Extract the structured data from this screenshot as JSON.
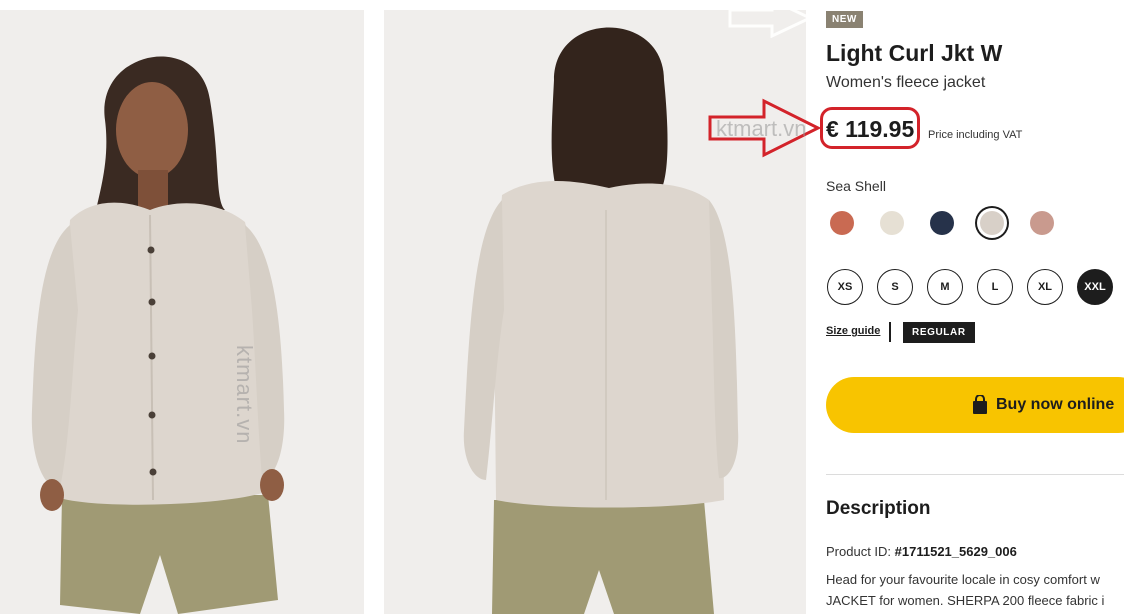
{
  "watermark": "ktmart.vn",
  "product": {
    "badge": "NEW",
    "title": "Light Curl Jkt W",
    "subtitle": "Women's fleece jacket",
    "price": "€ 119.95",
    "vat_note": "Price including VAT",
    "color_name": "Sea Shell"
  },
  "colors": [
    {
      "name": "coral",
      "hex": "#c96a52",
      "selected": false
    },
    {
      "name": "cream",
      "hex": "#e6e0d4",
      "selected": false
    },
    {
      "name": "navy",
      "hex": "#26324a",
      "selected": false
    },
    {
      "name": "sea-shell",
      "hex": "#d8d0c8",
      "selected": true
    },
    {
      "name": "rose",
      "hex": "#c99a8e",
      "selected": false
    }
  ],
  "sizes": [
    "XS",
    "S",
    "M",
    "L",
    "XL",
    "XXL"
  ],
  "selected_size": "XXL",
  "size_guide": "Size guide",
  "fit": "REGULAR",
  "buy_label": "Buy now online",
  "description": {
    "title": "Description",
    "product_id_label": "Product ID:",
    "product_id": "#1711521_5629_006",
    "line1": "Head for your favourite locale in cosy comfort w",
    "line2": "JACKET for women. SHERPA 200 fleece fabric i"
  },
  "accent_colors": {
    "buy_button": "#f8c400",
    "annotation": "#d3232a",
    "badge_new": "#8a8272"
  }
}
